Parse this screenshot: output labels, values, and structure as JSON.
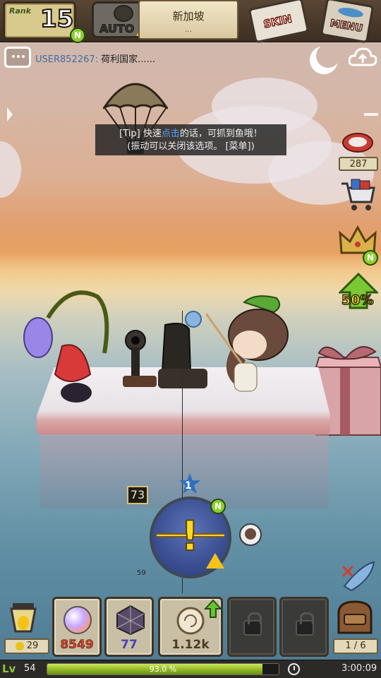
{
  "top": {
    "rank_label": "Rank",
    "rank_value": "15",
    "rank_badge": "N",
    "auto_label": "AUTO",
    "region": "新加坡",
    "region_sub": "...",
    "skin_label": "SKIN",
    "menu_label": "MENU"
  },
  "chat": {
    "user": "USER852267:",
    "message": "荷利国家......"
  },
  "tip": {
    "line1_a": "[Tip] 快速",
    "line1_hl": "点击",
    "line1_b": "的话，可抓到鱼哦！",
    "line2": "(振动可以关闭该选项。 [菜单])"
  },
  "side": {
    "meat_count": "287",
    "crown_badge": "N",
    "boost_label": "50%"
  },
  "fishing": {
    "tension": "73",
    "star_count": "1",
    "depth": "59",
    "gauge_badge": "N"
  },
  "slots": {
    "lantern_count": "29",
    "pearl_value": "8549",
    "web_value": "77",
    "shell_value": "1.12k",
    "bag_count": "1 / 6"
  },
  "status": {
    "level": "54",
    "xp_percent": 93.0,
    "xp_text": "93.0 %",
    "timer": "3:00:09"
  },
  "colors": {
    "accent_blue": "#4ea3ff",
    "xp_green": "#8cb321",
    "pearl_text": "#d9472b",
    "web_text": "#4a3fb5",
    "shell_text": "#4c3a22"
  }
}
